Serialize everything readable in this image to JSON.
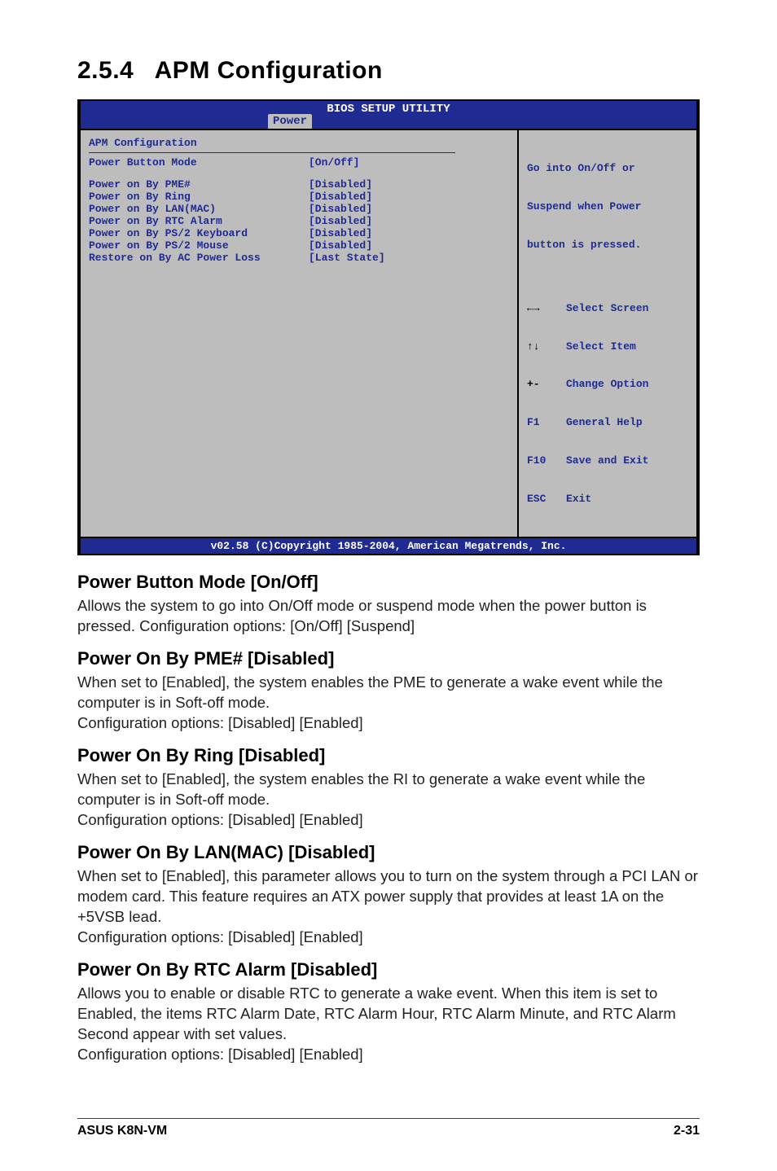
{
  "headings": {
    "section_number": "2.5.4",
    "section_title": "APM Configuration"
  },
  "bios": {
    "header_title": "BIOS SETUP UTILITY",
    "tab": "Power",
    "left_title": "APM Configuration",
    "rows": [
      {
        "label": "Power Button Mode",
        "value": "[On/Off]"
      }
    ],
    "rows2": [
      {
        "label": "Power on By PME#",
        "value": "[Disabled]"
      },
      {
        "label": "Power on By Ring",
        "value": "[Disabled]"
      },
      {
        "label": "Power on By LAN(MAC)",
        "value": "[Disabled]"
      },
      {
        "label": "Power on By RTC Alarm",
        "value": "[Disabled]"
      },
      {
        "label": "Power on By PS/2 Keyboard",
        "value": "[Disabled]"
      },
      {
        "label": "Power on By PS/2 Mouse",
        "value": "[Disabled]"
      },
      {
        "label": "Restore on By AC Power Loss",
        "value": "[Last State]"
      }
    ],
    "help_top_1": "Go into On/Off or",
    "help_top_2": "Suspend when Power",
    "help_top_3": "button is pressed.",
    "nav": [
      {
        "key": "←→",
        "text": "Select Screen",
        "key_class": "bios-nav-key"
      },
      {
        "key": "↑↓",
        "text": "Select Item",
        "key_class": "bios-nav-key"
      },
      {
        "key": "+-",
        "text": "Change Option",
        "key_class": "bios-nav-key"
      },
      {
        "key": "F1",
        "text": "General Help",
        "key_class": "bios-nav-key-blue"
      },
      {
        "key": "F10",
        "text": "Save and Exit",
        "key_class": "bios-nav-key-blue"
      },
      {
        "key": "ESC",
        "text": "Exit",
        "key_class": "bios-nav-key-blue"
      }
    ],
    "footer": "v02.58 (C)Copyright 1985-2004, American Megatrends, Inc."
  },
  "sections": {
    "pbm_h": "Power Button Mode [On/Off]",
    "pbm_p": "Allows the system to go into On/Off mode or suspend mode when the power  button is pressed. Configuration options: [On/Off] [Suspend]",
    "pme_h": "Power On By PME# [Disabled]",
    "pme_p1": "When set to [Enabled], the system enables the PME to generate a wake event while the computer is in Soft-off mode.",
    "pme_p2": "Configuration options: [Disabled] [Enabled]",
    "ring_h": "Power On By Ring [Disabled]",
    "ring_p1": "When set to [Enabled], the system enables the RI to generate a wake event while the computer is in Soft-off mode.",
    "ring_p2": "Configuration options: [Disabled] [Enabled]",
    "lan_h": "Power On By LAN(MAC) [Disabled]",
    "lan_p1": "When set to [Enabled], this parameter allows you to turn on the system through a PCI LAN or modem card. This feature requires an ATX power supply that provides at least 1A on the +5VSB lead.",
    "lan_p2": "Configuration options: [Disabled] [Enabled]",
    "rtc_h": "Power On By RTC Alarm [Disabled]",
    "rtc_p1": "Allows you to enable or disable RTC to generate a wake event. When this item is set to Enabled, the items RTC Alarm Date, RTC Alarm Hour, RTC Alarm Minute, and RTC Alarm Second appear with set values.",
    "rtc_p2": "Configuration options: [Disabled] [Enabled]"
  },
  "footer": {
    "left": "ASUS K8N-VM",
    "right": "2-31"
  }
}
